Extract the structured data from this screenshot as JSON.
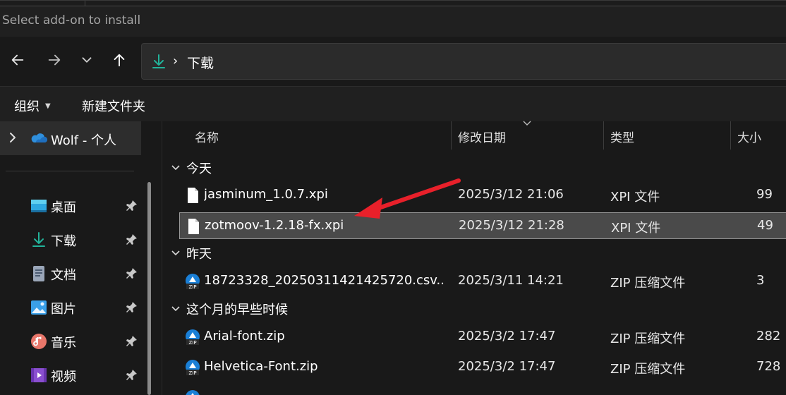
{
  "window": {
    "title": "Select add-on to install"
  },
  "nav": {
    "back_icon": "arrow-left-icon",
    "forward_icon": "arrow-right-icon",
    "recent_icon": "chevron-down-icon",
    "up_icon": "arrow-up-icon",
    "breadcrumb_separator": "›",
    "breadcrumb": "下载"
  },
  "toolbar": {
    "organize_label": "组织",
    "new_folder_label": "新建文件夹"
  },
  "sidebar": {
    "home_label": "Wolf - 个人",
    "items": [
      {
        "label": "桌面",
        "icon": "desktop-icon"
      },
      {
        "label": "下载",
        "icon": "download-icon"
      },
      {
        "label": "文档",
        "icon": "documents-icon"
      },
      {
        "label": "图片",
        "icon": "pictures-icon"
      },
      {
        "label": "音乐",
        "icon": "music-icon"
      },
      {
        "label": "视频",
        "icon": "videos-icon"
      }
    ]
  },
  "columns": {
    "name": "名称",
    "modified": "修改日期",
    "type": "类型",
    "size": "大小"
  },
  "groups": [
    {
      "label": "今天"
    },
    {
      "label": "昨天"
    },
    {
      "label": "这个月的早些时候"
    }
  ],
  "files": [
    {
      "name": "jasminum_1.0.7.xpi",
      "date": "2025/3/12 21:06",
      "type": "XPI 文件",
      "size": "99",
      "icon": "file-icon"
    },
    {
      "name": "zotmoov-1.2.18-fx.xpi",
      "date": "2025/3/12 21:28",
      "type": "XPI 文件",
      "size": "49",
      "icon": "file-icon",
      "selected": true
    },
    {
      "name": "18723328_20250311421425720.csv...",
      "date": "2025/3/11 14:21",
      "type": "ZIP 压缩文件",
      "size": "3",
      "icon": "zip-icon"
    },
    {
      "name": "Arial-font.zip",
      "date": "2025/3/2 17:47",
      "type": "ZIP 压缩文件",
      "size": "282",
      "icon": "zip-icon"
    },
    {
      "name": "Helvetica-Font.zip",
      "date": "2025/3/2 17:47",
      "type": "ZIP 压缩文件",
      "size": "728",
      "icon": "zip-icon"
    }
  ],
  "colors": {
    "accent": "#0f9d8a",
    "selection": "#4a4a4a",
    "annotation_arrow": "#e8202a"
  }
}
